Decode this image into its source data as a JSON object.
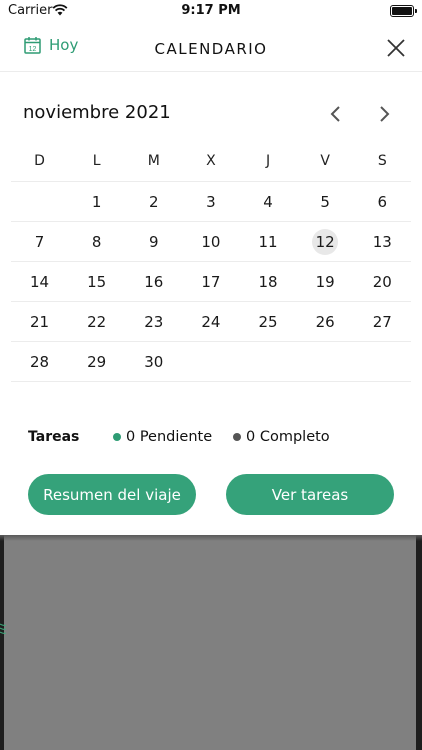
{
  "status_bar": {
    "carrier": "Carrier",
    "time": "9:17 PM"
  },
  "header": {
    "today_label": "Hoy",
    "title": "CALENDARIO"
  },
  "calendar": {
    "month_label": "noviembre 2021",
    "weekdays": [
      "D",
      "L",
      "M",
      "X",
      "J",
      "V",
      "S"
    ],
    "weeks": [
      [
        "",
        "1",
        "2",
        "3",
        "4",
        "5",
        "6"
      ],
      [
        "7",
        "8",
        "9",
        "10",
        "11",
        "12",
        "13"
      ],
      [
        "14",
        "15",
        "16",
        "17",
        "18",
        "19",
        "20"
      ],
      [
        "21",
        "22",
        "23",
        "24",
        "25",
        "26",
        "27"
      ],
      [
        "28",
        "29",
        "30",
        "",
        "",
        "",
        ""
      ]
    ],
    "selected_day": "12"
  },
  "tasks": {
    "label": "Tareas",
    "pending": "0 Pendiente",
    "complete": "0 Completo"
  },
  "buttons": {
    "summary": "Resumen del viaje",
    "view_tasks": "Ver tareas"
  },
  "colors": {
    "accent": "#2e9c74",
    "button": "#35a27a",
    "complete_dot": "#555555",
    "today_highlight": "#e8e8e8",
    "overlay": "#808080"
  }
}
